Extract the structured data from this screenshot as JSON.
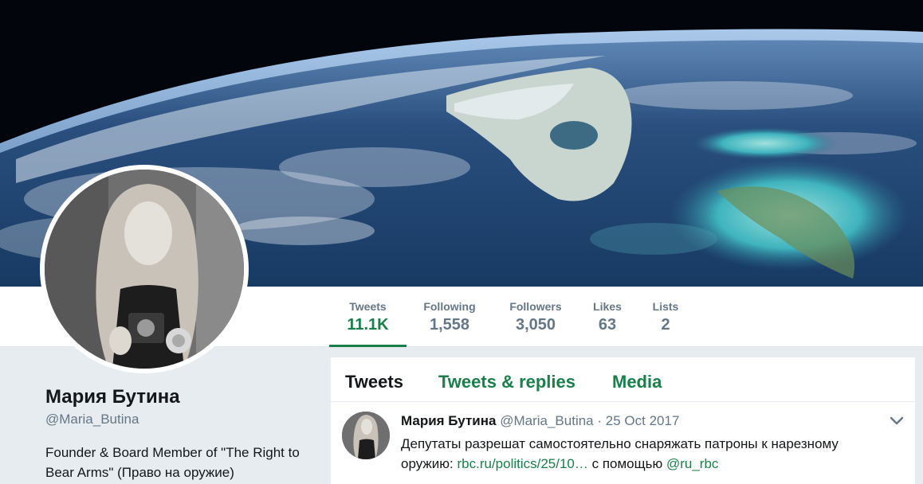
{
  "profile": {
    "name": "Мария Бутина",
    "handle": "@Maria_Butina",
    "bio": "Founder & Board Member of \"The Right to Bear Arms\" (Право на оружие)"
  },
  "stats": [
    {
      "label": "Tweets",
      "value": "11.1K",
      "active": true
    },
    {
      "label": "Following",
      "value": "1,558",
      "active": false
    },
    {
      "label": "Followers",
      "value": "3,050",
      "active": false
    },
    {
      "label": "Likes",
      "value": "63",
      "active": false
    },
    {
      "label": "Lists",
      "value": "2",
      "active": false
    }
  ],
  "tabs": [
    {
      "label": "Tweets",
      "active": true
    },
    {
      "label": "Tweets & replies",
      "active": false
    },
    {
      "label": "Media",
      "active": false
    }
  ],
  "tweet": {
    "name": "Мария Бутина",
    "handle": "@Maria_Butina",
    "separator": "·",
    "time": "25 Oct 2017",
    "text_before": "Депутаты разрешат самостоятельно снаряжать патроны к нарезному оружию: ",
    "link": "rbc.ru/politics/25/10…",
    "text_middle": " с помощью ",
    "mention": "@ru_rbc",
    "menu_icon": "chevron-down-icon"
  },
  "colors": {
    "accent": "#1a7f4a",
    "muted": "#657786",
    "background": "#e6ecf0"
  }
}
